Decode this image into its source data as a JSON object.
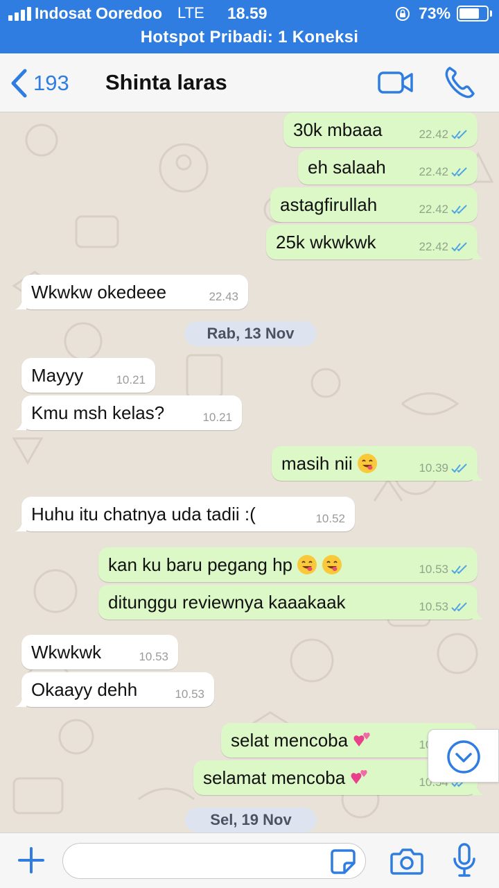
{
  "status_bar": {
    "carrier": "Indosat Ooredoo",
    "network": "LTE",
    "time": "18.59",
    "battery_percent": "73%",
    "battery_level": 0.73,
    "hotspot": "Hotspot Pribadi: 1 Koneksi"
  },
  "header": {
    "back_count": "193",
    "contact_name": "Shinta laras",
    "accent_color": "#2f7de1"
  },
  "messages": [
    {
      "dir": "out",
      "text": "30k mbaaa",
      "time": "22.42",
      "read": true
    },
    {
      "dir": "out",
      "text": "eh salaah",
      "time": "22.42",
      "read": true
    },
    {
      "dir": "out",
      "text": "astagfirullah",
      "time": "22.42",
      "read": true
    },
    {
      "dir": "out",
      "text": "25k wkwkwk",
      "time": "22.42",
      "read": true
    },
    {
      "dir": "in",
      "text": "Wkwkw okedeee",
      "time": "22.43"
    },
    {
      "type": "date",
      "text": "Rab, 13 Nov"
    },
    {
      "dir": "in",
      "text": "Mayyy",
      "time": "10.21"
    },
    {
      "dir": "in",
      "text": "Kmu msh kelas?",
      "time": "10.21"
    },
    {
      "dir": "out",
      "text": "masih nii",
      "emoji": [
        "face-savoring-food-emoji"
      ],
      "time": "10.39",
      "read": true
    },
    {
      "dir": "in",
      "text": "Huhu itu chatnya uda tadii :(",
      "time": "10.52"
    },
    {
      "dir": "out",
      "text": "kan ku baru pegang hp",
      "emoji": [
        "face-savoring-food-emoji",
        "face-savoring-food-emoji"
      ],
      "time": "10.53",
      "read": true
    },
    {
      "dir": "out",
      "text": "ditunggu reviewnya kaaakaak",
      "time": "10.53",
      "read": true
    },
    {
      "dir": "in",
      "text": "Wkwkwk",
      "time": "10.53"
    },
    {
      "dir": "in",
      "text": "Okaayy dehh",
      "time": "10.53"
    },
    {
      "dir": "out",
      "text": "selat mencoba",
      "emoji": [
        "two-hearts-emoji"
      ],
      "time": "10.54",
      "read": true
    },
    {
      "dir": "out",
      "text": "selamat mencoba",
      "emoji": [
        "two-hearts-emoji"
      ],
      "time": "10.54",
      "read": true
    },
    {
      "type": "date",
      "text": "Sel, 19 Nov"
    }
  ],
  "input": {
    "placeholder": "",
    "value": ""
  },
  "icons": {
    "back": "chevron-left-icon",
    "video": "video-camera-icon",
    "call": "phone-icon",
    "scroll": "chevron-down-circle-icon",
    "plus": "plus-icon",
    "sticker": "sticker-icon",
    "camera": "camera-icon",
    "mic": "microphone-icon"
  },
  "colors": {
    "outgoing_bubble": "#dcf8c6",
    "incoming_bubble": "#ffffff",
    "read_tick": "#4fa3e6",
    "date_pill": "#dde4ef"
  }
}
